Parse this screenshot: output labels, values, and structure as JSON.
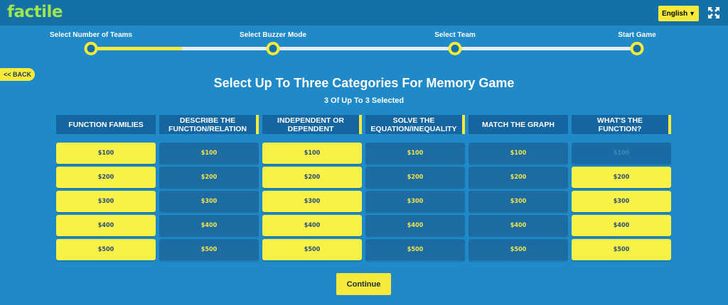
{
  "app": {
    "logo": "factile"
  },
  "header": {
    "language": "English",
    "language_chevron": "chevron-down-icon",
    "fullscreen_icon": "expand-icon"
  },
  "steps": [
    {
      "label": "Select Number of Teams"
    },
    {
      "label": "Select Buzzer Mode"
    },
    {
      "label": "Select Team"
    },
    {
      "label": "Start Game"
    }
  ],
  "progress": {
    "fraction": 0.167
  },
  "back": {
    "label": "<< BACK"
  },
  "page": {
    "title": "Select Up To Three Categories For Memory Game",
    "subtitle": "3 Of Up To 3 Selected"
  },
  "categories": [
    {
      "name": "Function Families",
      "selected": false
    },
    {
      "name": "Describe the Function/Relation",
      "selected": true
    },
    {
      "name": "Independent or Dependent",
      "selected": true
    },
    {
      "name": "Solve the Equation/Inequality",
      "selected": true
    },
    {
      "name": "Match the Graph",
      "selected": false
    },
    {
      "name": "What's the Function?",
      "selected": true
    }
  ],
  "board": {
    "values": [
      "$100",
      "$200",
      "$300",
      "$400",
      "$500"
    ],
    "tile_states": [
      [
        "on",
        "off",
        "on",
        "off",
        "off",
        "disabled"
      ],
      [
        "on",
        "off",
        "on",
        "off",
        "off",
        "on"
      ],
      [
        "on",
        "off",
        "on",
        "off",
        "off",
        "on"
      ],
      [
        "on",
        "off",
        "on",
        "off",
        "off",
        "on"
      ],
      [
        "on",
        "off",
        "on",
        "off",
        "off",
        "on"
      ]
    ]
  },
  "continue": {
    "label": "Continue"
  },
  "colors": {
    "background": "#1f8ac7",
    "topbar": "#1570a6",
    "accent_yellow": "#f7ea3b",
    "logo_green": "#9ee64f"
  }
}
